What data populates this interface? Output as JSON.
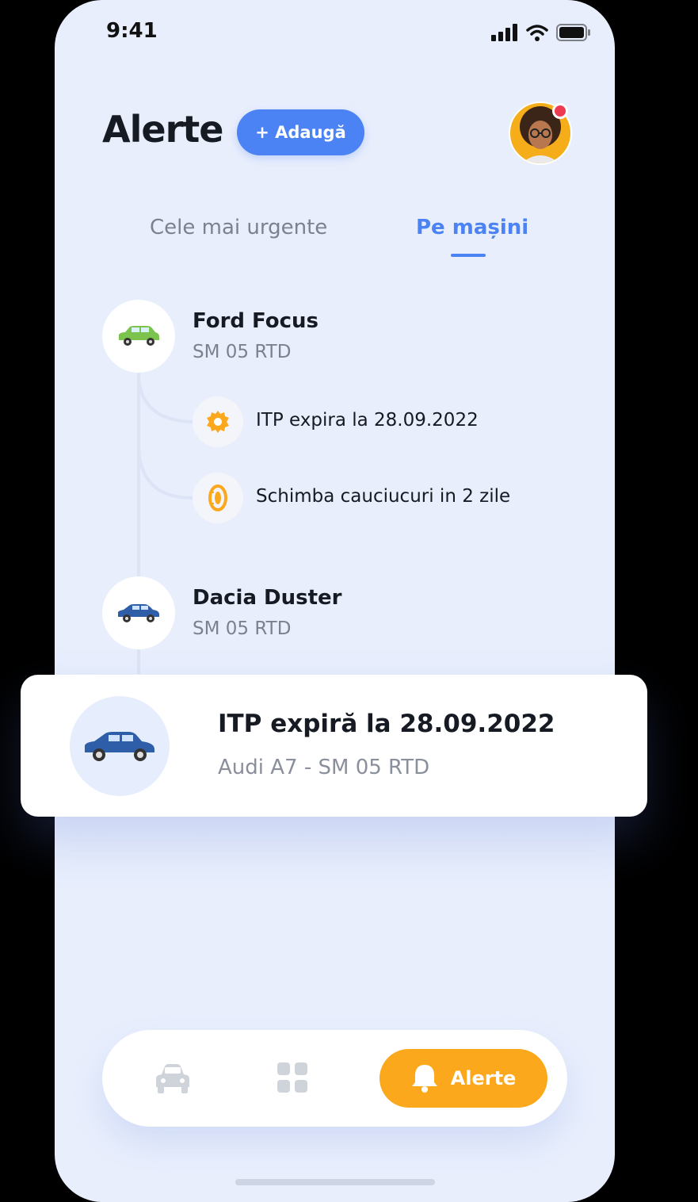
{
  "status": {
    "time": "9:41"
  },
  "header": {
    "title": "Alerte",
    "add_label": "+ Adaugă"
  },
  "tabs": [
    {
      "label": "Cele mai urgente",
      "active": false
    },
    {
      "label": "Pe mașini",
      "active": true
    }
  ],
  "cars": [
    {
      "name": "Ford Focus",
      "plate": "SM 05 RTD",
      "icon": "car-green-icon",
      "alerts": [
        {
          "icon": "gear-icon",
          "text": "ITP expira la 28.09.2022"
        },
        {
          "icon": "tire-icon",
          "text": "Schimba cauciucuri in 2 zile"
        }
      ]
    },
    {
      "name": "Dacia Duster",
      "plate": "SM 05 RTD",
      "icon": "car-blue-icon",
      "alerts": []
    }
  ],
  "notification_card": {
    "title": "ITP expiră la 28.09.2022",
    "subtitle": "Audi A7 - SM 05 RTD",
    "icon": "car-blue-icon"
  },
  "bottom_nav": {
    "items": [
      {
        "icon": "car-icon",
        "active": false
      },
      {
        "icon": "grid-icon",
        "active": false
      },
      {
        "icon": "bell-icon",
        "label": "Alerte",
        "active": true
      }
    ]
  },
  "colors": {
    "accent": "#4b82f4",
    "active_nav": "#fba81c",
    "background": "#e8eefc"
  }
}
